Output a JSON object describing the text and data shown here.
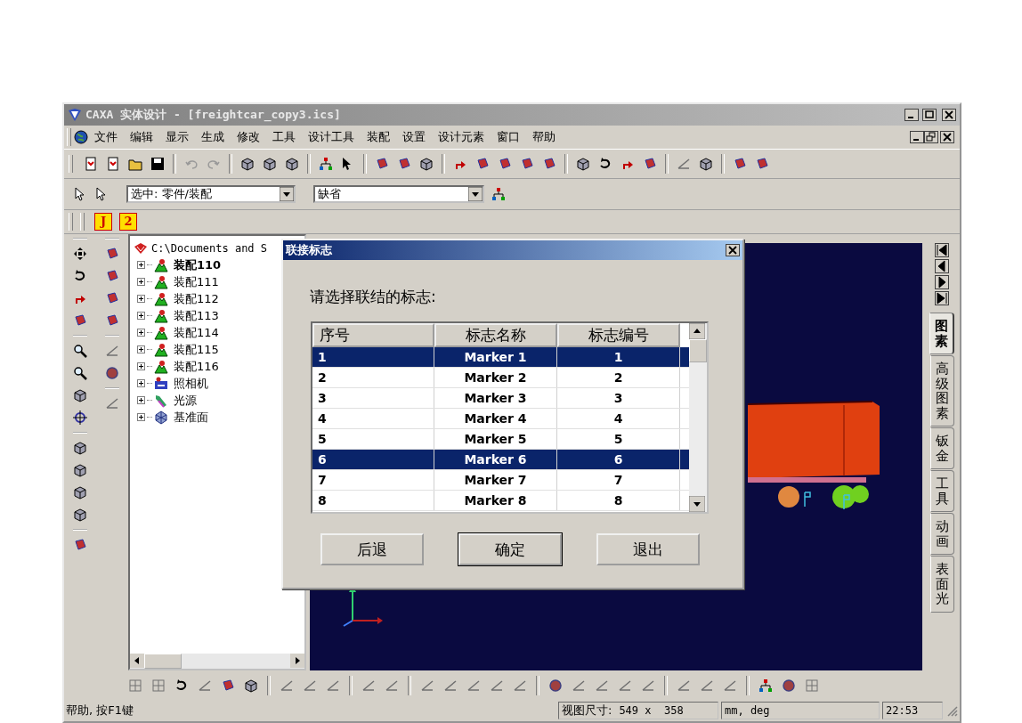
{
  "window": {
    "title": "CAXA 实体设计 - [freightcar_copy3.ics]"
  },
  "menu": [
    "文件",
    "编辑",
    "显示",
    "生成",
    "修改",
    "工具",
    "设计工具",
    "装配",
    "设置",
    "设计元素",
    "窗口",
    "帮助"
  ],
  "selection_toolbar": {
    "filter": "选中: 零件/装配",
    "style": "缺省"
  },
  "layout_toolbar": {
    "buttons": [
      "J",
      "2"
    ]
  },
  "tree": {
    "root": "C:\\Documents and S",
    "items": [
      {
        "label": "装配110",
        "kind": "assembly",
        "active": true,
        "expanded": false
      },
      {
        "label": "装配111",
        "kind": "assembly",
        "active": false,
        "expanded": false
      },
      {
        "label": "装配112",
        "kind": "assembly",
        "active": false,
        "expanded": false
      },
      {
        "label": "装配113",
        "kind": "assembly",
        "active": false,
        "expanded": false
      },
      {
        "label": "装配114",
        "kind": "assembly",
        "active": false,
        "expanded": false
      },
      {
        "label": "装配115",
        "kind": "assembly",
        "active": false,
        "expanded": false
      },
      {
        "label": "装配116",
        "kind": "assembly",
        "active": false,
        "expanded": false
      },
      {
        "label": "照相机",
        "kind": "camera",
        "active": false,
        "expanded": false
      },
      {
        "label": "光源",
        "kind": "light",
        "active": false,
        "expanded": false
      },
      {
        "label": "基准面",
        "kind": "plane",
        "active": false,
        "expanded": false
      }
    ]
  },
  "right_tabs": [
    {
      "label": "图素",
      "selected": true
    },
    {
      "label": "高级图素",
      "selected": false
    },
    {
      "label": "钣金",
      "selected": false
    },
    {
      "label": "工具",
      "selected": false
    },
    {
      "label": "动画",
      "selected": false
    },
    {
      "label": "表面光",
      "selected": false
    }
  ],
  "dialog": {
    "title": "联接标志",
    "prompt": "请选择联结的标志:",
    "columns": [
      "序号",
      "标志名称",
      "标志编号"
    ],
    "rows": [
      {
        "cells": [
          "1",
          "Marker 1",
          "1"
        ],
        "selected": true
      },
      {
        "cells": [
          "2",
          "Marker 2",
          "2"
        ],
        "selected": false
      },
      {
        "cells": [
          "3",
          "Marker 3",
          "3"
        ],
        "selected": false
      },
      {
        "cells": [
          "4",
          "Marker 4",
          "4"
        ],
        "selected": false
      },
      {
        "cells": [
          "5",
          "Marker 5",
          "5"
        ],
        "selected": false
      },
      {
        "cells": [
          "6",
          "Marker 6",
          "6"
        ],
        "selected": true
      },
      {
        "cells": [
          "7",
          "Marker 7",
          "7"
        ],
        "selected": false
      },
      {
        "cells": [
          "8",
          "Marker 8",
          "8"
        ],
        "selected": false
      }
    ],
    "buttons": [
      {
        "label": "后退",
        "default": false
      },
      {
        "label": "确定",
        "default": true
      },
      {
        "label": "退出",
        "default": false
      }
    ]
  },
  "status_bar": {
    "help": "帮助, 按F1键",
    "view_size_label": "视图尺寸:",
    "view_size": "549 x  358",
    "units": "mm, deg",
    "time": "22:53"
  }
}
